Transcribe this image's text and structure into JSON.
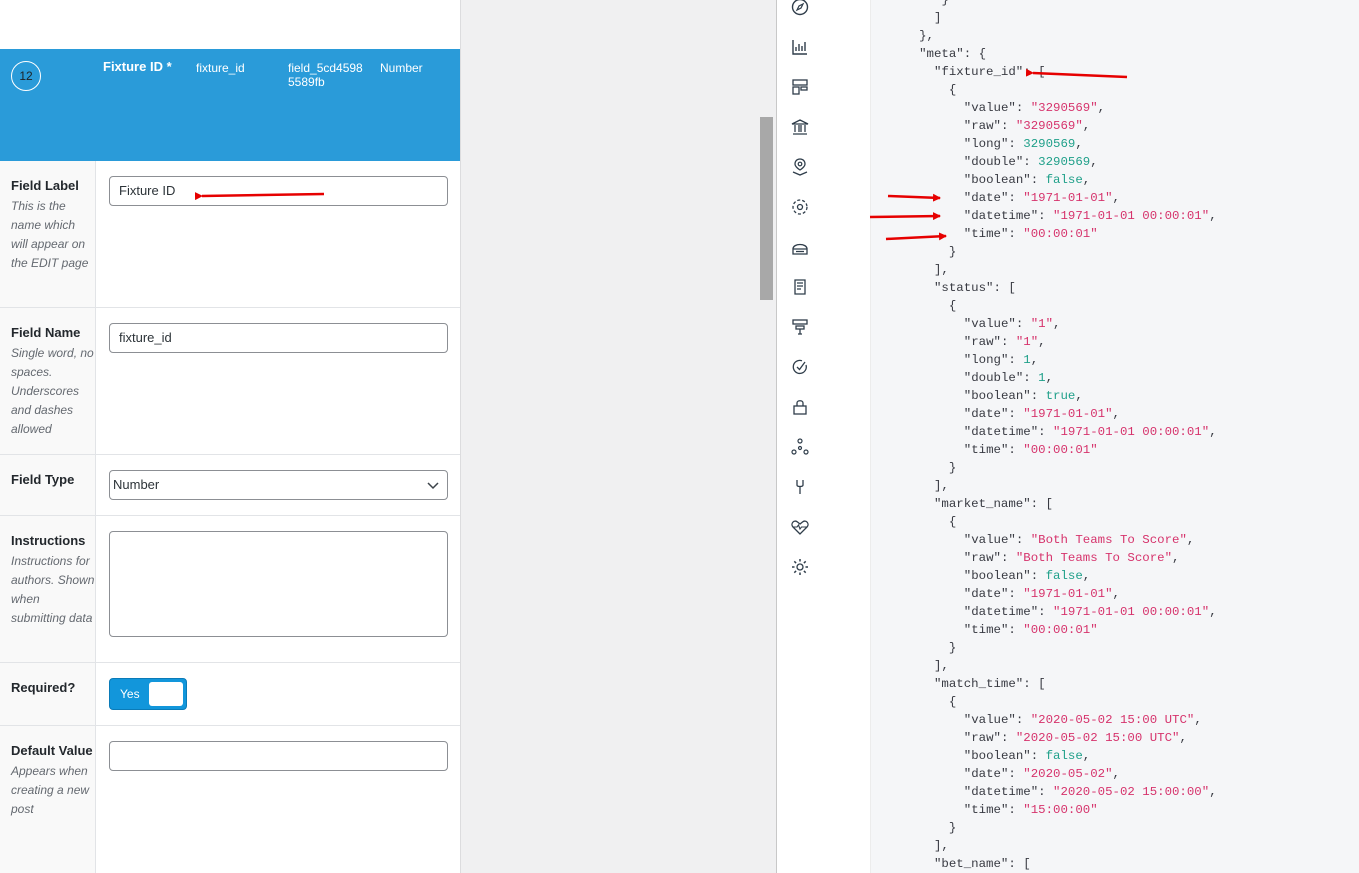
{
  "field_header": {
    "order": "12",
    "label": "Fixture ID *",
    "name": "fixture_id",
    "key": "field_5cd45985589fb",
    "type": "Number"
  },
  "rows": [
    {
      "label": "Field Label",
      "desc": "This is the name which will appear on the EDIT page",
      "value": "Fixture ID"
    },
    {
      "label": "Field Name",
      "desc": "Single word, no spaces. Underscores and dashes allowed",
      "value": "fixture_id"
    },
    {
      "label": "Field Type",
      "desc": "",
      "value": "Number"
    },
    {
      "label": "Instructions",
      "desc": "Instructions for authors. Shown when submitting data",
      "value": ""
    },
    {
      "label": "Required?",
      "desc": "",
      "value": "Yes"
    },
    {
      "label": "Default Value",
      "desc": "Appears when creating a new post",
      "value": ""
    }
  ],
  "icons": [
    "compass-icon",
    "chart-icon",
    "layout-icon",
    "bank-icon",
    "map-pin-icon",
    "sync-icon",
    "database-icon",
    "document-icon",
    "funnel-icon",
    "check-icon",
    "lock-icon",
    "network-icon",
    "tool-icon",
    "heartbeat-icon",
    "gear-icon"
  ],
  "code_lines": [
    [
      [
        12,
        "}",
        "k"
      ]
    ],
    [
      [
        11,
        "]",
        "k"
      ]
    ],
    [
      [
        9,
        "},",
        "k"
      ]
    ],
    [
      [
        9,
        "\"meta\"",
        "k"
      ],
      [
        0,
        ": {",
        "k"
      ]
    ],
    [
      [
        11,
        "\"fixture_id\"",
        "k"
      ],
      [
        0,
        ": [",
        "k"
      ]
    ],
    [
      [
        13,
        "{",
        "k"
      ]
    ],
    [
      [
        15,
        "\"value\"",
        "k"
      ],
      [
        0,
        ": ",
        "k"
      ],
      [
        0,
        "\"3290569\"",
        "s"
      ],
      [
        0,
        ",",
        "k"
      ]
    ],
    [
      [
        15,
        "\"raw\"",
        "k"
      ],
      [
        0,
        ": ",
        "k"
      ],
      [
        0,
        "\"3290569\"",
        "s"
      ],
      [
        0,
        ",",
        "k"
      ]
    ],
    [
      [
        15,
        "\"long\"",
        "k"
      ],
      [
        0,
        ": ",
        "k"
      ],
      [
        0,
        "3290569",
        "n"
      ],
      [
        0,
        ",",
        "k"
      ]
    ],
    [
      [
        15,
        "\"double\"",
        "k"
      ],
      [
        0,
        ": ",
        "k"
      ],
      [
        0,
        "3290569",
        "n"
      ],
      [
        0,
        ",",
        "k"
      ]
    ],
    [
      [
        15,
        "\"boolean\"",
        "k"
      ],
      [
        0,
        ": ",
        "k"
      ],
      [
        0,
        "false",
        "b"
      ],
      [
        0,
        ",",
        "k"
      ]
    ],
    [
      [
        15,
        "\"date\"",
        "k"
      ],
      [
        0,
        ": ",
        "k"
      ],
      [
        0,
        "\"1971-01-01\"",
        "s"
      ],
      [
        0,
        ",",
        "k"
      ]
    ],
    [
      [
        15,
        "\"datetime\"",
        "k"
      ],
      [
        0,
        ": ",
        "k"
      ],
      [
        0,
        "\"1971-01-01 00:00:01\"",
        "s"
      ],
      [
        0,
        ",",
        "k"
      ]
    ],
    [
      [
        15,
        "\"time\"",
        "k"
      ],
      [
        0,
        ": ",
        "k"
      ],
      [
        0,
        "\"00:00:01\"",
        "s"
      ]
    ],
    [
      [
        13,
        "}",
        "k"
      ]
    ],
    [
      [
        11,
        "],",
        "k"
      ]
    ],
    [
      [
        11,
        "\"status\"",
        "k"
      ],
      [
        0,
        ": [",
        "k"
      ]
    ],
    [
      [
        13,
        "{",
        "k"
      ]
    ],
    [
      [
        15,
        "\"value\"",
        "k"
      ],
      [
        0,
        ": ",
        "k"
      ],
      [
        0,
        "\"1\"",
        "s"
      ],
      [
        0,
        ",",
        "k"
      ]
    ],
    [
      [
        15,
        "\"raw\"",
        "k"
      ],
      [
        0,
        ": ",
        "k"
      ],
      [
        0,
        "\"1\"",
        "s"
      ],
      [
        0,
        ",",
        "k"
      ]
    ],
    [
      [
        15,
        "\"long\"",
        "k"
      ],
      [
        0,
        ": ",
        "k"
      ],
      [
        0,
        "1",
        "n"
      ],
      [
        0,
        ",",
        "k"
      ]
    ],
    [
      [
        15,
        "\"double\"",
        "k"
      ],
      [
        0,
        ": ",
        "k"
      ],
      [
        0,
        "1",
        "n"
      ],
      [
        0,
        ",",
        "k"
      ]
    ],
    [
      [
        15,
        "\"boolean\"",
        "k"
      ],
      [
        0,
        ": ",
        "k"
      ],
      [
        0,
        "true",
        "b"
      ],
      [
        0,
        ",",
        "k"
      ]
    ],
    [
      [
        15,
        "\"date\"",
        "k"
      ],
      [
        0,
        ": ",
        "k"
      ],
      [
        0,
        "\"1971-01-01\"",
        "s"
      ],
      [
        0,
        ",",
        "k"
      ]
    ],
    [
      [
        15,
        "\"datetime\"",
        "k"
      ],
      [
        0,
        ": ",
        "k"
      ],
      [
        0,
        "\"1971-01-01 00:00:01\"",
        "s"
      ],
      [
        0,
        ",",
        "k"
      ]
    ],
    [
      [
        15,
        "\"time\"",
        "k"
      ],
      [
        0,
        ": ",
        "k"
      ],
      [
        0,
        "\"00:00:01\"",
        "s"
      ]
    ],
    [
      [
        13,
        "}",
        "k"
      ]
    ],
    [
      [
        11,
        "],",
        "k"
      ]
    ],
    [
      [
        11,
        "\"market_name\"",
        "k"
      ],
      [
        0,
        ": [",
        "k"
      ]
    ],
    [
      [
        13,
        "{",
        "k"
      ]
    ],
    [
      [
        15,
        "\"value\"",
        "k"
      ],
      [
        0,
        ": ",
        "k"
      ],
      [
        0,
        "\"Both Teams To Score\"",
        "s"
      ],
      [
        0,
        ",",
        "k"
      ]
    ],
    [
      [
        15,
        "\"raw\"",
        "k"
      ],
      [
        0,
        ": ",
        "k"
      ],
      [
        0,
        "\"Both Teams To Score\"",
        "s"
      ],
      [
        0,
        ",",
        "k"
      ]
    ],
    [
      [
        15,
        "\"boolean\"",
        "k"
      ],
      [
        0,
        ": ",
        "k"
      ],
      [
        0,
        "false",
        "b"
      ],
      [
        0,
        ",",
        "k"
      ]
    ],
    [
      [
        15,
        "\"date\"",
        "k"
      ],
      [
        0,
        ": ",
        "k"
      ],
      [
        0,
        "\"1971-01-01\"",
        "s"
      ],
      [
        0,
        ",",
        "k"
      ]
    ],
    [
      [
        15,
        "\"datetime\"",
        "k"
      ],
      [
        0,
        ": ",
        "k"
      ],
      [
        0,
        "\"1971-01-01 00:00:01\"",
        "s"
      ],
      [
        0,
        ",",
        "k"
      ]
    ],
    [
      [
        15,
        "\"time\"",
        "k"
      ],
      [
        0,
        ": ",
        "k"
      ],
      [
        0,
        "\"00:00:01\"",
        "s"
      ]
    ],
    [
      [
        13,
        "}",
        "k"
      ]
    ],
    [
      [
        11,
        "],",
        "k"
      ]
    ],
    [
      [
        11,
        "\"match_time\"",
        "k"
      ],
      [
        0,
        ": [",
        "k"
      ]
    ],
    [
      [
        13,
        "{",
        "k"
      ]
    ],
    [
      [
        15,
        "\"value\"",
        "k"
      ],
      [
        0,
        ": ",
        "k"
      ],
      [
        0,
        "\"2020-05-02 15:00 UTC\"",
        "s"
      ],
      [
        0,
        ",",
        "k"
      ]
    ],
    [
      [
        15,
        "\"raw\"",
        "k"
      ],
      [
        0,
        ": ",
        "k"
      ],
      [
        0,
        "\"2020-05-02 15:00 UTC\"",
        "s"
      ],
      [
        0,
        ",",
        "k"
      ]
    ],
    [
      [
        15,
        "\"boolean\"",
        "k"
      ],
      [
        0,
        ": ",
        "k"
      ],
      [
        0,
        "false",
        "b"
      ],
      [
        0,
        ",",
        "k"
      ]
    ],
    [
      [
        15,
        "\"date\"",
        "k"
      ],
      [
        0,
        ": ",
        "k"
      ],
      [
        0,
        "\"2020-05-02\"",
        "s"
      ],
      [
        0,
        ",",
        "k"
      ]
    ],
    [
      [
        15,
        "\"datetime\"",
        "k"
      ],
      [
        0,
        ": ",
        "k"
      ],
      [
        0,
        "\"2020-05-02 15:00:00\"",
        "s"
      ],
      [
        0,
        ",",
        "k"
      ]
    ],
    [
      [
        15,
        "\"time\"",
        "k"
      ],
      [
        0,
        ": ",
        "k"
      ],
      [
        0,
        "\"15:00:00\"",
        "s"
      ]
    ],
    [
      [
        13,
        "}",
        "k"
      ]
    ],
    [
      [
        11,
        "],",
        "k"
      ]
    ],
    [
      [
        11,
        "\"bet_name\"",
        "k"
      ],
      [
        0,
        ": [",
        "k"
      ]
    ]
  ],
  "colors": {
    "accent": "#2a9bd9",
    "toggle": "#1296db",
    "string": "#d6336c",
    "number": "#20a08a",
    "annotation_arrow": "#e60000"
  }
}
